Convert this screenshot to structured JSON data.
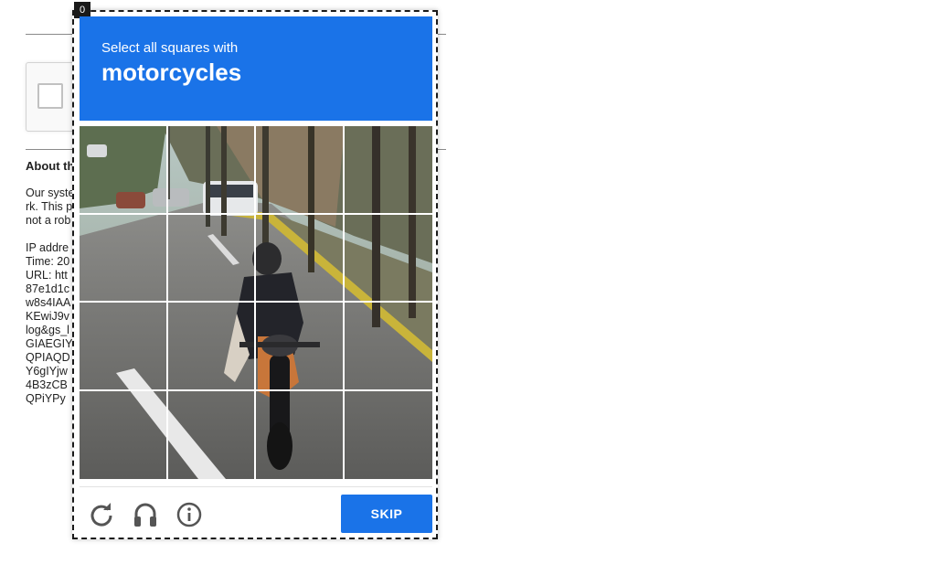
{
  "background_page": {
    "about_heading": "About th",
    "about_lines": [
      "Our syste",
      "rk. This p",
      "not a rob"
    ],
    "info_lines": [
      "IP addre",
      "Time: 20",
      "URL: htt",
      "87e1d1c",
      "w8s4IAA",
      "KEwiJ9v",
      "log&gs_l",
      "GIAEGIY",
      "QPIAQD",
      "Y6gIYjw",
      "4B3zCB",
      "QPiYPy"
    ]
  },
  "challenge": {
    "badge": "0",
    "instruction": "Select all squares with",
    "target": "motorcycles",
    "grid": {
      "rows": 4,
      "cols": 4
    },
    "skip_label": "SKIP",
    "icons": {
      "reload": "reload-icon",
      "audio": "headphones-icon",
      "info": "info-icon"
    },
    "colors": {
      "header": "#1a73e8",
      "button": "#1a73e8",
      "icon": "#555555"
    }
  }
}
